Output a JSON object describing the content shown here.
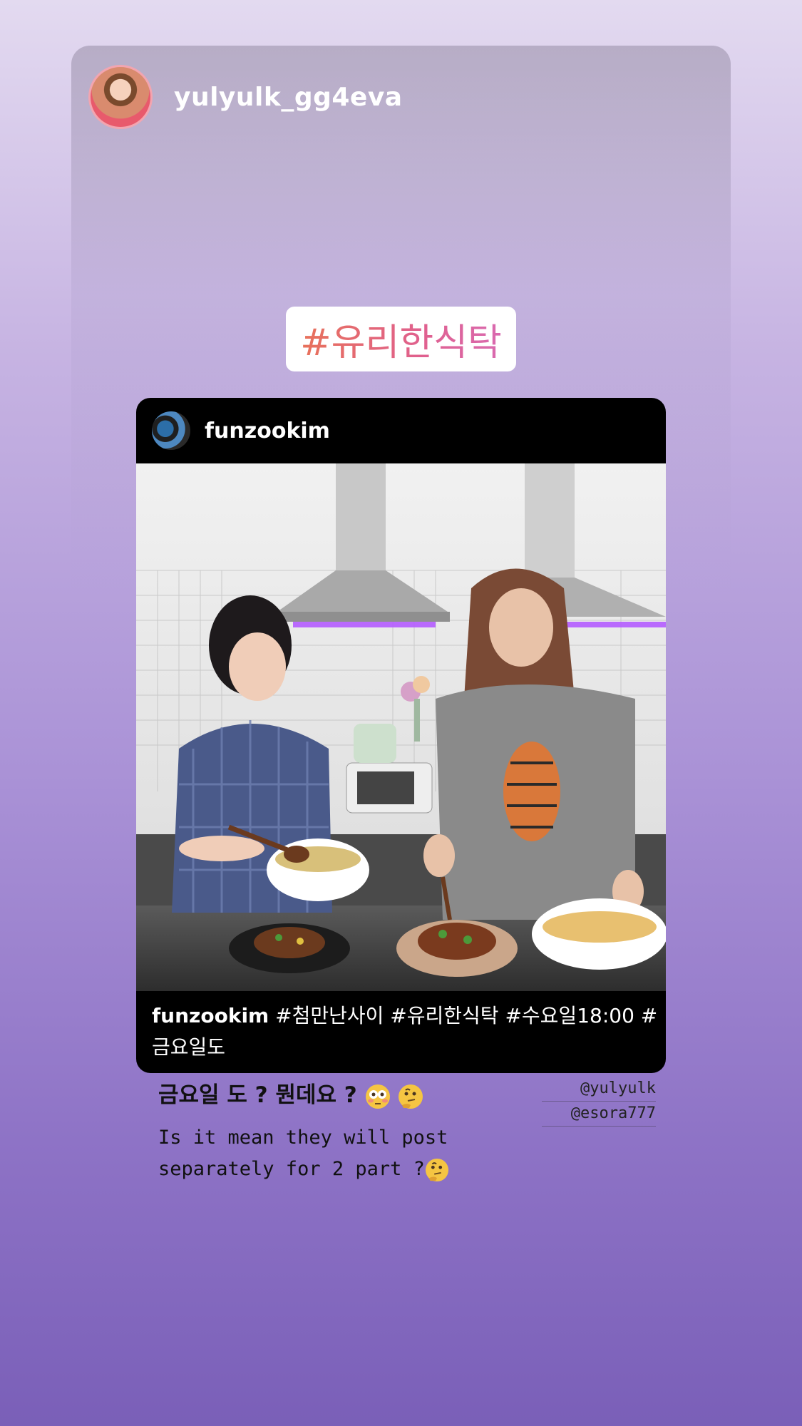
{
  "story": {
    "username": "yulyulk_gg4eva",
    "hashtag_sticker": "#유리한식탁"
  },
  "shared_post": {
    "username": "funzookim",
    "caption_user": "funzookim",
    "caption_tags_line1": "#첨만난사이 #유리한식탁 #수요일18:00 #",
    "caption_tags_line2": "금요일도"
  },
  "comment": {
    "korean_text": "금요일 도 ? 뭔데요 ?",
    "english_line1": "Is it mean they will post",
    "english_line2": "separately for 2 part ?",
    "mentions": [
      "@yulyulk",
      "@esora777"
    ]
  },
  "colors": {
    "background_top": "#e3daf0",
    "background_bottom": "#7a5fb8",
    "hashtag_gradient_start": "#e8725a",
    "hashtag_gradient_end": "#d96ab0"
  },
  "icons": [
    "flushed-emoji-icon",
    "thinking-emoji-icon"
  ]
}
